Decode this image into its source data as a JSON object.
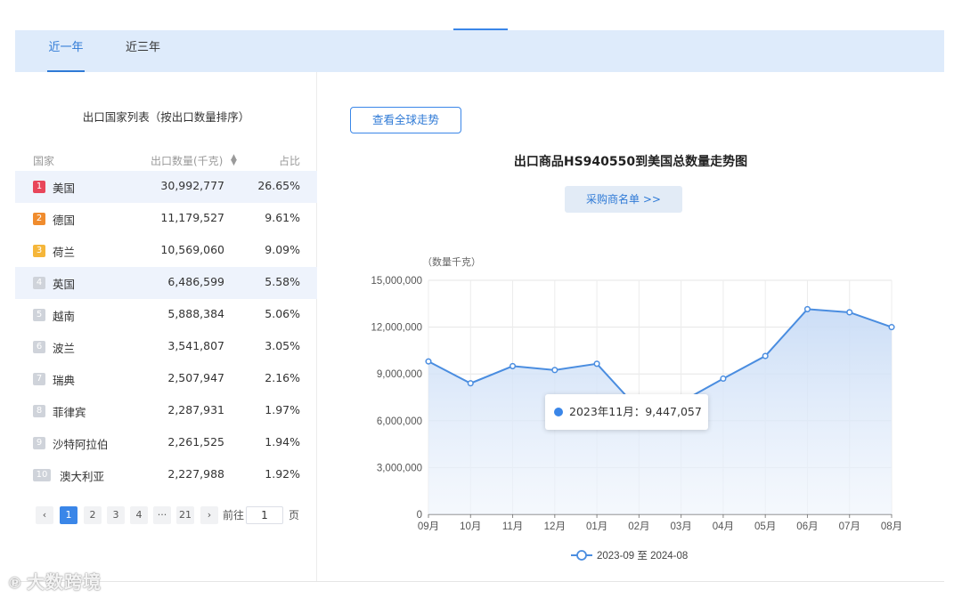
{
  "tabs": [
    {
      "label": "近一年",
      "active": true
    },
    {
      "label": "近三年",
      "active": false
    }
  ],
  "list": {
    "title": "出口国家列表（按出口数量排序）",
    "headers": {
      "country": "国家",
      "quantity": "出口数量(千克)",
      "share": "占比"
    },
    "rows": [
      {
        "rank": "1",
        "country": "美国",
        "quantity": "30,992,777",
        "share": "26.65%",
        "rank_color": "#e8465a"
      },
      {
        "rank": "2",
        "country": "德国",
        "quantity": "11,179,527",
        "share": "9.61%",
        "rank_color": "#f08c2e"
      },
      {
        "rank": "3",
        "country": "荷兰",
        "quantity": "10,569,060",
        "share": "9.09%",
        "rank_color": "#f5b63a"
      },
      {
        "rank": "4",
        "country": "英国",
        "quantity": "6,486,599",
        "share": "5.58%",
        "rank_color": "#cfd3da"
      },
      {
        "rank": "5",
        "country": "越南",
        "quantity": "5,888,384",
        "share": "5.06%",
        "rank_color": "#cfd3da"
      },
      {
        "rank": "6",
        "country": "波兰",
        "quantity": "3,541,807",
        "share": "3.05%",
        "rank_color": "#cfd3da"
      },
      {
        "rank": "7",
        "country": "瑞典",
        "quantity": "2,507,947",
        "share": "2.16%",
        "rank_color": "#cfd3da"
      },
      {
        "rank": "8",
        "country": "菲律宾",
        "quantity": "2,287,931",
        "share": "1.97%",
        "rank_color": "#cfd3da"
      },
      {
        "rank": "9",
        "country": "沙特阿拉伯",
        "quantity": "2,261,525",
        "share": "1.94%",
        "rank_color": "#cfd3da"
      },
      {
        "rank": "10",
        "country": "澳大利亚",
        "quantity": "2,227,988",
        "share": "1.92%",
        "rank_color": "#cfd3da"
      }
    ]
  },
  "pagination": {
    "prev": "‹",
    "pages": [
      "1",
      "2",
      "3",
      "4",
      "···",
      "21"
    ],
    "current": "1",
    "next": "›",
    "goto_label": "前往",
    "goto_value": "1",
    "page_suffix": "页"
  },
  "buttons": {
    "global_trend": "查看全球走势",
    "buyers_list": "采购商名单 >>"
  },
  "chart_data": {
    "type": "area",
    "title": "出口商品HS940550到美国总数量走势图",
    "ylabel": "（数量千克）",
    "xlabel": "",
    "ylim": [
      0,
      15000000
    ],
    "y_ticks": [
      "0",
      "3,000,000",
      "6,000,000",
      "9,000,000",
      "12,000,000",
      "15,000,000"
    ],
    "categories": [
      "09月",
      "10月",
      "11月",
      "12月",
      "01月",
      "02月",
      "03月",
      "04月",
      "05月",
      "06月",
      "07月",
      "08月"
    ],
    "series": [
      {
        "name": "2023-09 至 2024-08",
        "values": [
          9800000,
          8400000,
          9500000,
          9250000,
          9650000,
          6700000,
          7200000,
          8700000,
          10150000,
          13150000,
          12950000,
          12000000
        ]
      }
    ],
    "tooltip": "2023年11月：9,447,057",
    "grid": true,
    "legend_position": "bottom",
    "line_color": "#4a8de0"
  },
  "watermark": "大数跨境"
}
